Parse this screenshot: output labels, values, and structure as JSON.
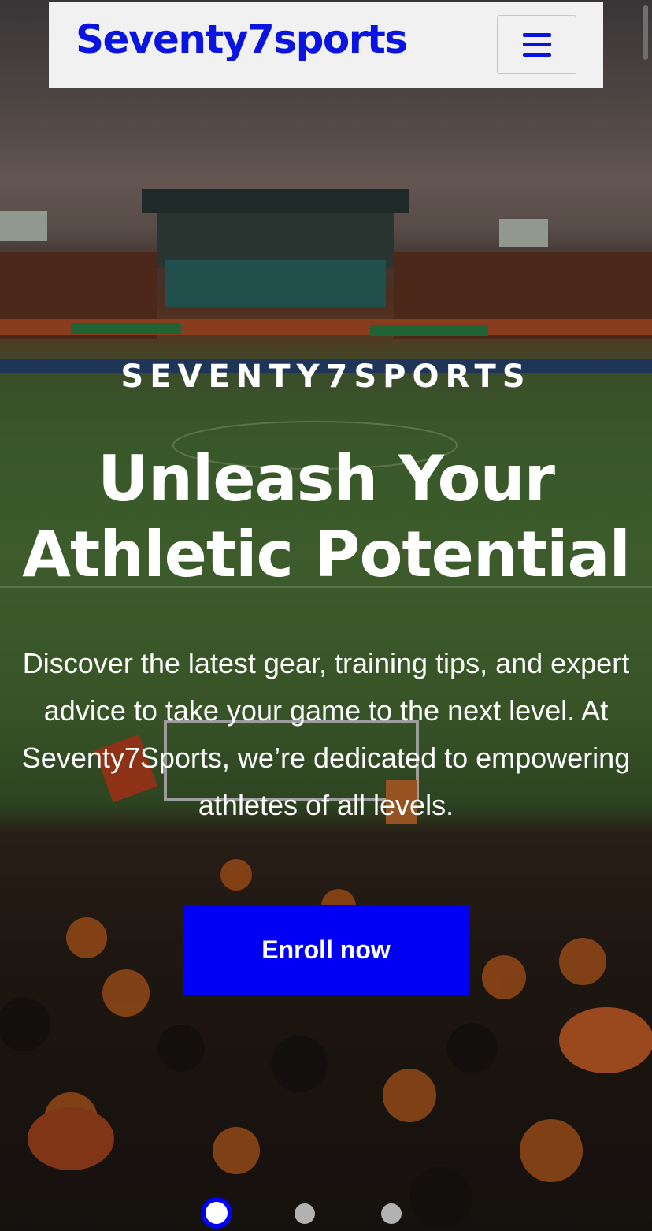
{
  "header": {
    "logo_text": "Seventy7sports",
    "menu_icon": "hamburger-menu-icon"
  },
  "hero": {
    "eyebrow": "SEVENTY7SPORTS",
    "headline_line1": "Unleash Your",
    "headline_line2": "Athletic Potential",
    "description": "Discover the latest gear, training tips, and expert advice to take your game to the next level. At Seventy7Sports, we’re dedicated to empowering athletes of all levels.",
    "cta_label": "Enroll now"
  },
  "carousel": {
    "slide_count": 3,
    "active_index": 0
  },
  "colors": {
    "brand_blue": "#0000f5",
    "logo_blue": "#0a14e0",
    "header_bg": "#f1f1f1"
  }
}
